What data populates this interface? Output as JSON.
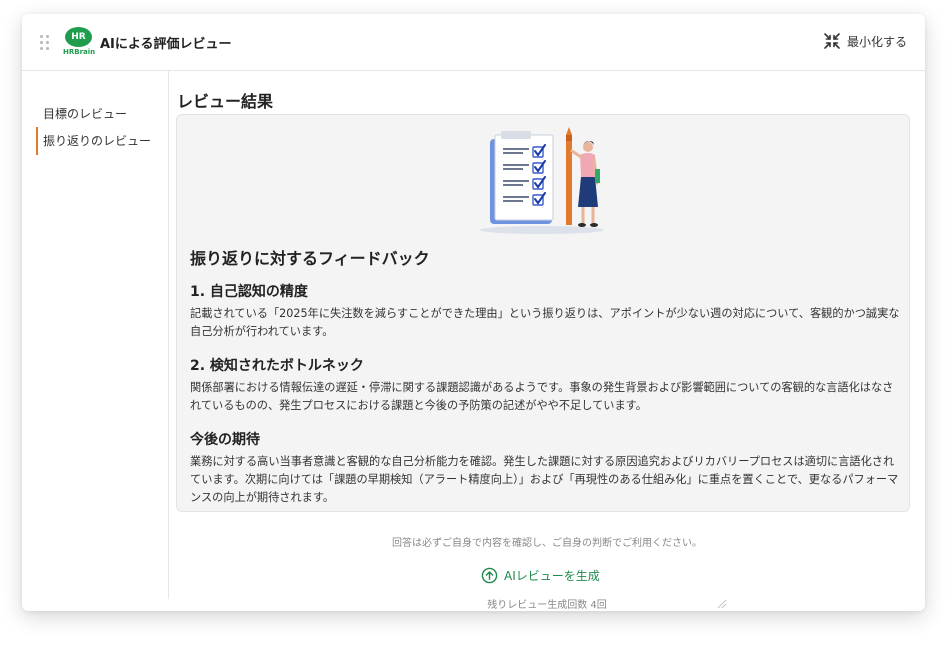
{
  "header": {
    "logo_text": "HR",
    "logo_brand": "HRBrain",
    "title": "AIによる評価レビュー",
    "minimize_label": "最小化する"
  },
  "sidebar": {
    "items": [
      {
        "label": "目標のレビュー",
        "active": false
      },
      {
        "label": "振り返りのレビュー",
        "active": true
      }
    ]
  },
  "main": {
    "title": "レビュー結果",
    "feedback_title": "振り返りに対するフィードバック",
    "sections": [
      {
        "heading": "1. 自己認知の精度",
        "body": "記載されている「2025年に失注数を減らすことができた理由」という振り返りは、アポイントが少ない週の対応について、客観的かつ誠実な自己分析が行われています。"
      },
      {
        "heading": "2. 検知されたボトルネック",
        "body": "関係部署における情報伝達の遅延・停滞に関する課題認識があるようです。事象の発生背景および影響範囲についての客観的な言語化はなされているものの、発生プロセスにおける課題と今後の予防策の記述がやや不足しています。"
      },
      {
        "heading": "今後の期待",
        "body": "業務に対する高い当事者意識と客観的な自己分析能力を確認。発生した課題に対する原因追究およびリカバリープロセスは適切に言語化されています。次期に向けては「課題の早期検知（アラート精度向上）」および「再現性のある仕組み化」に重点を置くことで、更なるパフォーマンスの向上が期待されます。"
      }
    ],
    "disclaimer": "回答は必ずご自身で内容を確認し、ご自身の判断でご利用ください。",
    "generate_label": "AIレビューを生成",
    "remaining_label": "残りレビュー生成回数 4回"
  },
  "colors": {
    "brand_green": "#1f9d4d",
    "accent_orange": "#e07a2e",
    "action_green": "#1f8a4c"
  },
  "icons": {
    "drag": "drag-handle-icon",
    "minimize": "minimize-arrows-icon",
    "generate": "arrow-up-circle-icon"
  }
}
